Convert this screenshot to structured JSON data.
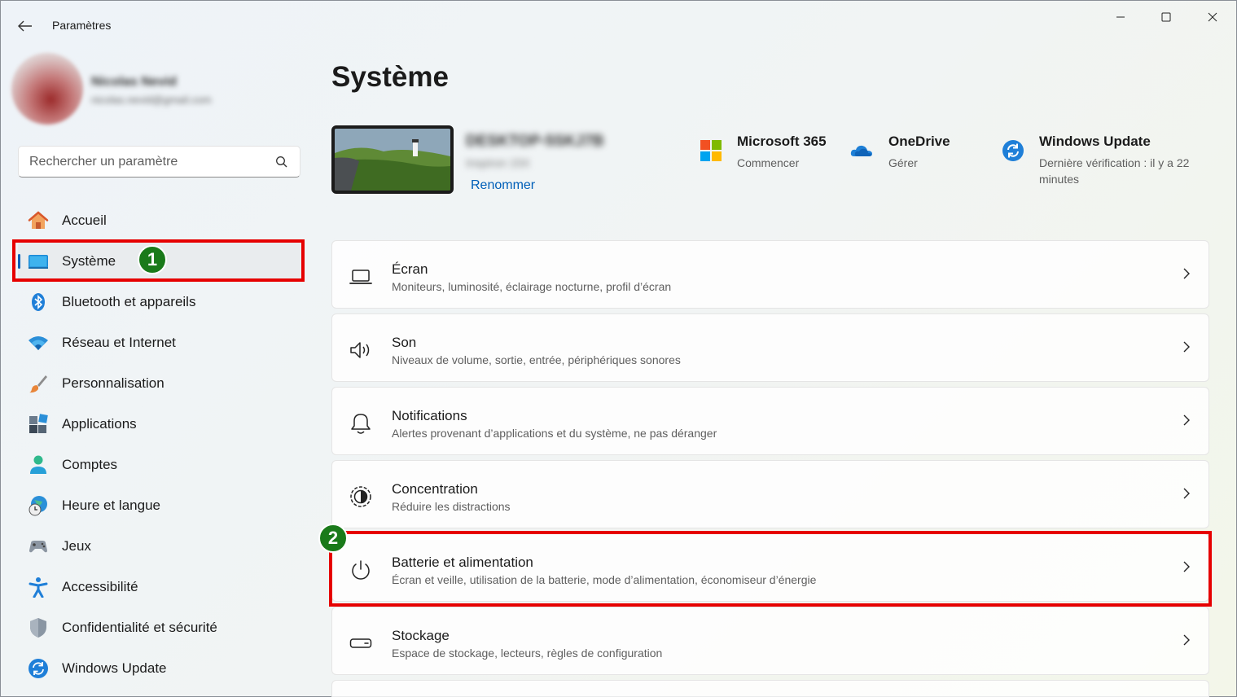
{
  "window": {
    "title": "Paramètres"
  },
  "profile": {
    "name": "Nicolas Nevid",
    "email": "nicolas.nevid@gmail.com"
  },
  "search": {
    "placeholder": "Rechercher un paramètre"
  },
  "sidebar": {
    "items": [
      {
        "label": "Accueil",
        "icon": "home-icon"
      },
      {
        "label": "Système",
        "icon": "display-icon"
      },
      {
        "label": "Bluetooth et appareils",
        "icon": "bluetooth-icon"
      },
      {
        "label": "Réseau et Internet",
        "icon": "wifi-icon"
      },
      {
        "label": "Personnalisation",
        "icon": "brush-icon"
      },
      {
        "label": "Applications",
        "icon": "apps-icon"
      },
      {
        "label": "Comptes",
        "icon": "person-icon"
      },
      {
        "label": "Heure et langue",
        "icon": "clock-globe-icon"
      },
      {
        "label": "Jeux",
        "icon": "gamepad-icon"
      },
      {
        "label": "Accessibilité",
        "icon": "accessibility-icon"
      },
      {
        "label": "Confidentialité et sécurité",
        "icon": "shield-icon"
      },
      {
        "label": "Windows Update",
        "icon": "update-icon"
      }
    ],
    "active_index": 1
  },
  "annotations": {
    "badge1": "1",
    "badge2": "2"
  },
  "main": {
    "title": "Système",
    "device": {
      "name": "DESKTOP-5SKJ7B",
      "model": "Inspiron 15X",
      "rename_label": "Renommer"
    },
    "quick_links": [
      {
        "title": "Microsoft 365",
        "subtitle": "Commencer",
        "icon": "microsoft-logo-icon"
      },
      {
        "title": "OneDrive",
        "subtitle": "Gérer",
        "icon": "onedrive-cloud-icon"
      },
      {
        "title": "Windows Update",
        "subtitle": "Dernière vérification : il y a 22 minutes",
        "icon": "windows-update-icon"
      }
    ],
    "cards": [
      {
        "title": "Écran",
        "subtitle": "Moniteurs, luminosité, éclairage nocturne, profil d’écran",
        "icon": "laptop-icon"
      },
      {
        "title": "Son",
        "subtitle": "Niveaux de volume, sortie, entrée, périphériques sonores",
        "icon": "speaker-icon"
      },
      {
        "title": "Notifications",
        "subtitle": "Alertes provenant d’applications et du système, ne pas déranger",
        "icon": "bell-icon"
      },
      {
        "title": "Concentration",
        "subtitle": "Réduire les distractions",
        "icon": "focus-icon"
      },
      {
        "title": "Batterie et alimentation",
        "subtitle": "Écran et veille, utilisation de la batterie, mode d’alimentation, économiseur d’énergie",
        "icon": "power-icon"
      },
      {
        "title": "Stockage",
        "subtitle": "Espace de stockage, lecteurs, règles de configuration",
        "icon": "storage-icon"
      }
    ]
  },
  "colors": {
    "accent": "#005fb8",
    "highlight_red": "#e60000",
    "badge_green": "#1a7a1a"
  }
}
